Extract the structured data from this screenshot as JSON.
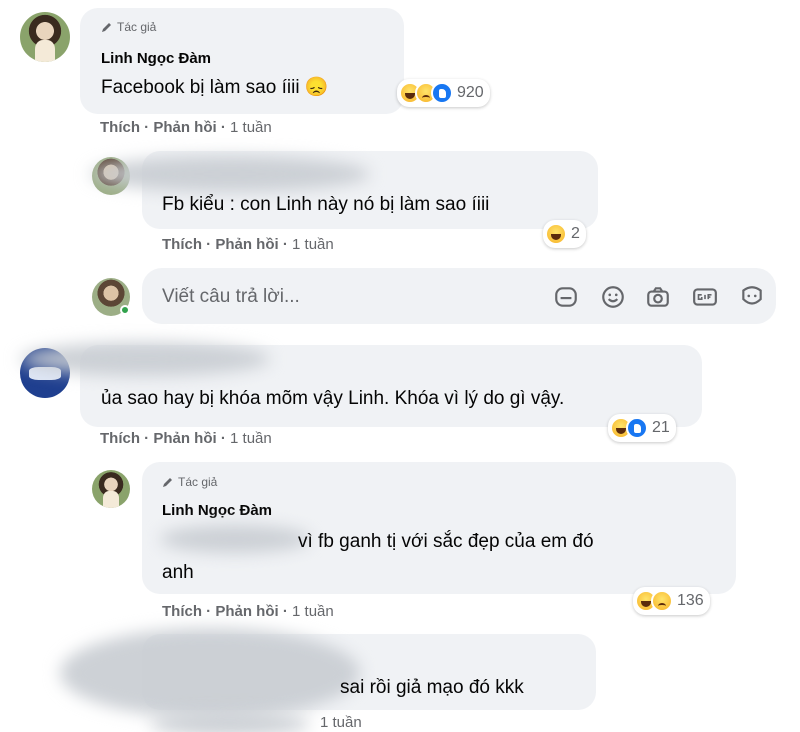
{
  "comments": [
    {
      "author_tag": "Tác giả",
      "name": "Linh Ngọc Đàm",
      "text": "Facebook bị làm sao íiii 😞",
      "reaction_count": "920",
      "actions": {
        "like": "Thích",
        "reply": "Phản hồi",
        "time": "1 tuần"
      }
    },
    {
      "text": "Fb kiểu : con Linh này nó bị làm sao íiii",
      "reaction_count": "2",
      "actions": {
        "like": "Thích",
        "reply": "Phản hồi",
        "time": "1 tuần"
      }
    },
    {
      "text": "ủa sao hay bị khóa mõm vậy Linh. Khóa vì lý do gì vậy.",
      "reaction_count": "21",
      "actions": {
        "like": "Thích",
        "reply": "Phản hồi",
        "time": "1 tuần"
      }
    },
    {
      "author_tag": "Tác giả",
      "name": "Linh Ngọc Đàm",
      "text_line1": "vì fb ganh tị với sắc đẹp của em đó",
      "text_line2": "anh",
      "reaction_count": "136",
      "actions": {
        "like": "Thích",
        "reply": "Phản hồi",
        "time": "1 tuần"
      }
    },
    {
      "text": "sai rồi giả mạo đó kkk",
      "actions": {
        "time": "1 tuần"
      }
    }
  ],
  "reply_box": {
    "placeholder": "Viết câu trả lời...",
    "icons": [
      "sticker-icon",
      "emoji-icon",
      "camera-icon",
      "gif-icon",
      "avatar-sticker-icon"
    ]
  },
  "separator": " · "
}
